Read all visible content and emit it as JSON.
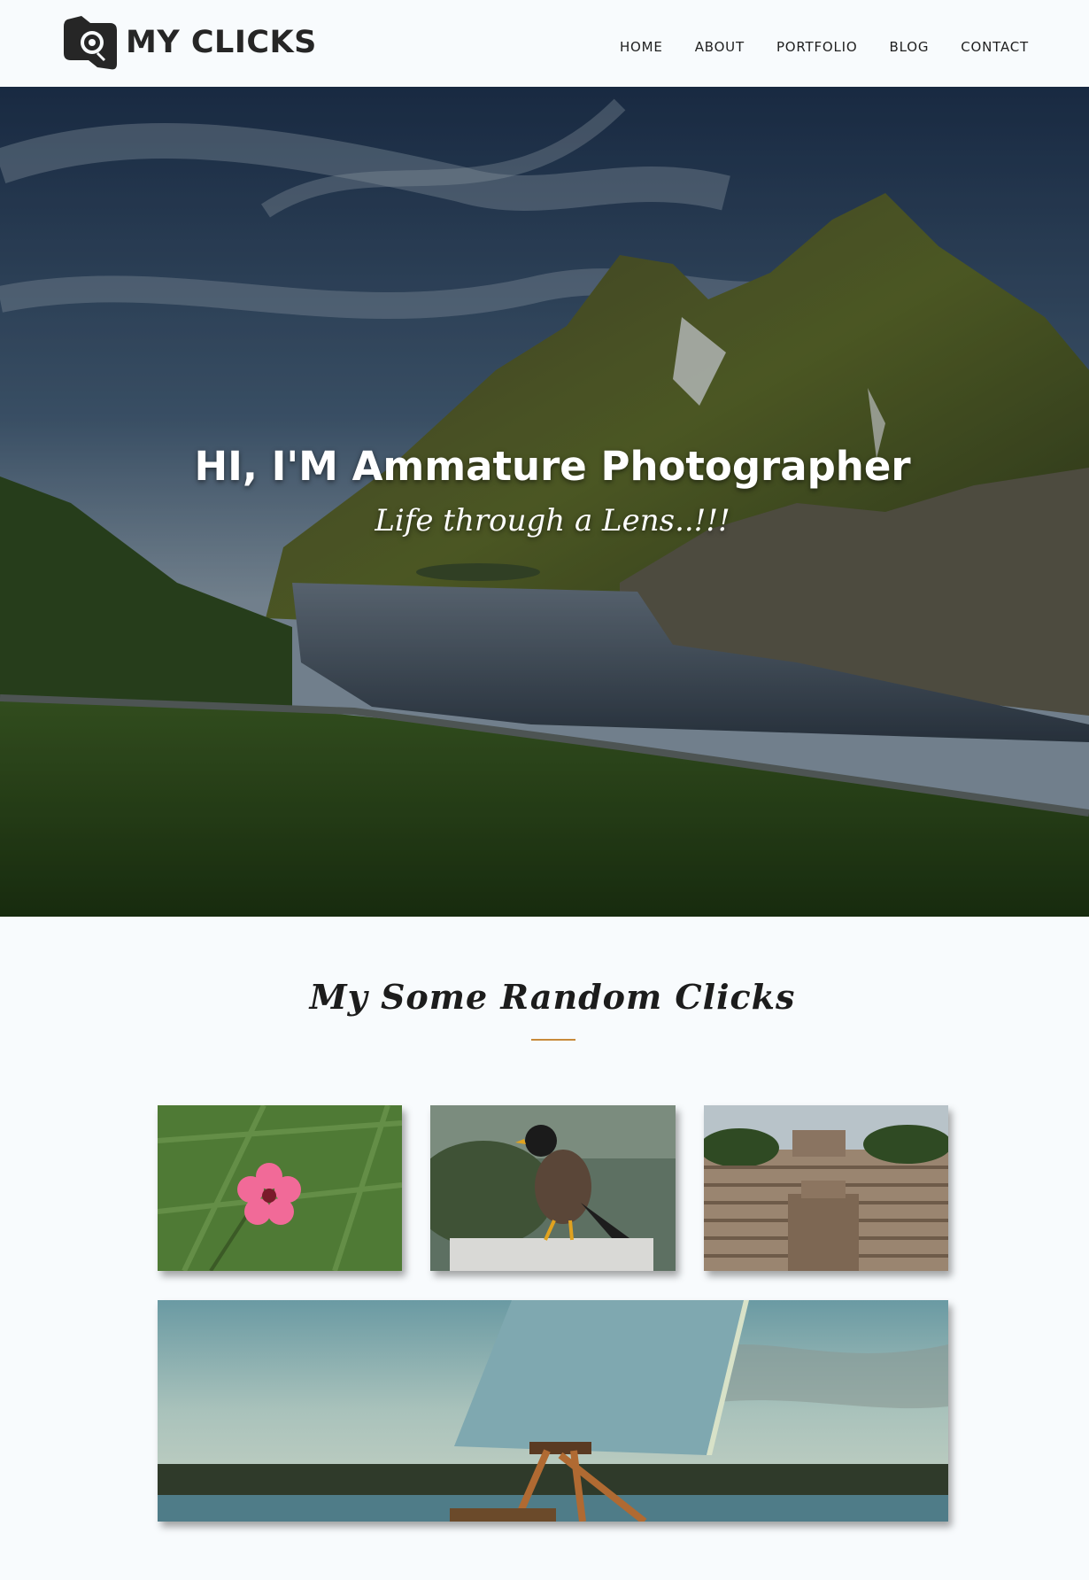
{
  "brand": {
    "name": "MY CLICKS",
    "icon": "camera-logo-icon"
  },
  "nav": [
    {
      "label": "HOME"
    },
    {
      "label": "ABOUT"
    },
    {
      "label": "PORTFOLIO"
    },
    {
      "label": "BLOG"
    },
    {
      "label": "CONTACT"
    }
  ],
  "hero": {
    "title": "HI, I'M Ammature Photographer",
    "subtitle": "Life through a Lens..!!!"
  },
  "gallery": {
    "title": "My Some Random Clicks"
  },
  "colors": {
    "background": "#f8fbfd",
    "accent": "#c88a3a",
    "text": "#222222"
  }
}
